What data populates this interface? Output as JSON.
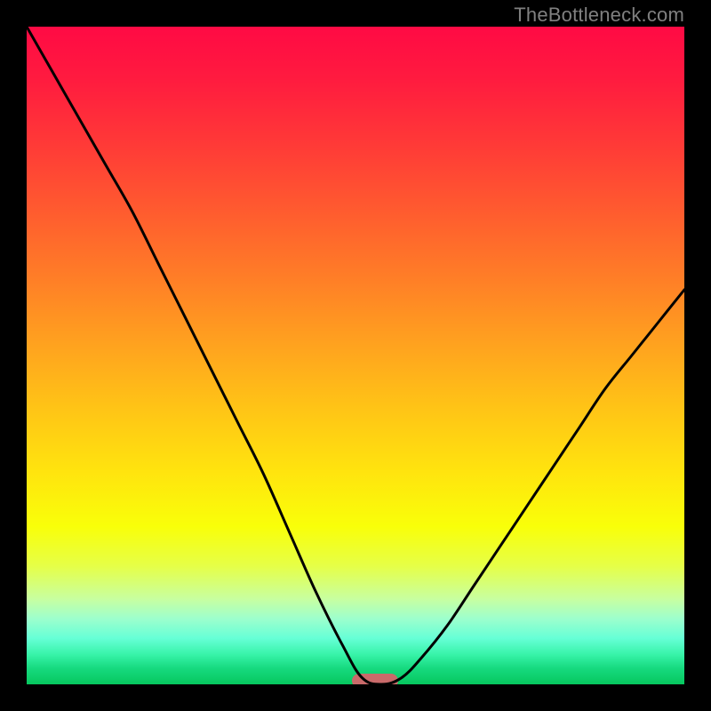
{
  "attribution": "TheBottleneck.com",
  "chart_data": {
    "type": "line",
    "title": "",
    "xlabel": "",
    "ylabel": "",
    "xlim": [
      0,
      100
    ],
    "ylim": [
      0,
      100
    ],
    "series": [
      {
        "name": "bottleneck-curve",
        "x": [
          0,
          4,
          8,
          12,
          16,
          20,
          24,
          28,
          32,
          36,
          40,
          44,
          48,
          51,
          54,
          57,
          60,
          64,
          68,
          72,
          76,
          80,
          84,
          88,
          92,
          96,
          100
        ],
        "values": [
          100,
          93,
          86,
          79,
          72,
          64,
          56,
          48,
          40,
          32,
          23,
          14,
          6,
          1,
          0,
          1,
          4,
          9,
          15,
          21,
          27,
          33,
          39,
          45,
          50,
          55,
          60
        ]
      }
    ],
    "marker": {
      "x_center": 53,
      "y": 0.5,
      "width": 7,
      "height": 2.2
    },
    "gradient": {
      "top": "#ff0a44",
      "bottom": "#06c75e"
    }
  }
}
